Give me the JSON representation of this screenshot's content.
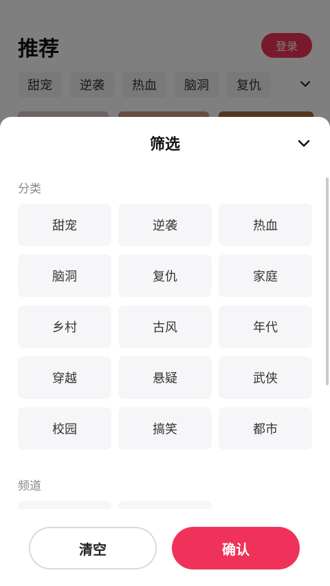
{
  "colors": {
    "accent": "#f0325a",
    "chip_bg": "#f6f6f8",
    "overlay": "rgba(0,0,0,0.5)"
  },
  "background_page": {
    "title": "推荐",
    "login_label": "登录",
    "tabs": [
      "甜宠",
      "逆袭",
      "热血",
      "脑洞",
      "复仇"
    ],
    "expand_icon": "chevron-down-icon"
  },
  "sheet": {
    "title": "筛选",
    "close_icon": "chevron-down-icon",
    "category_label": "分类",
    "categories": [
      "甜宠",
      "逆袭",
      "热血",
      "脑洞",
      "复仇",
      "家庭",
      "乡村",
      "古风",
      "年代",
      "穿越",
      "悬疑",
      "武侠",
      "校园",
      "搞笑",
      "都市"
    ],
    "channel_label": "频道"
  },
  "footer": {
    "clear_label": "清空",
    "confirm_label": "确认"
  }
}
